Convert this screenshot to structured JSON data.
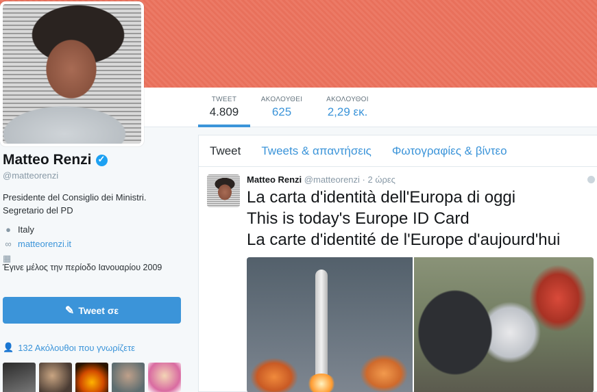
{
  "profile": {
    "name": "Matteo Renzi",
    "handle": "@matteorenzi",
    "bio": "Presidente del Consiglio dei Ministri. Segretario del PD",
    "location": "Italy",
    "website": "matteorenzi.it",
    "joined": "Έγινε μέλος την περίοδο Ιανουαρίου 2009",
    "tweet_to_button": "Tweet σε",
    "followers_you_know": "132 Ακόλουθοι που γνωρίζετε"
  },
  "stats": [
    {
      "label": "TWEET",
      "value": "4.809"
    },
    {
      "label": "ΑΚΟΛΟΥΘΕΙ",
      "value": "625"
    },
    {
      "label": "ΑΚΟΛΟΥΘΟΙ",
      "value": "2,29 εκ."
    }
  ],
  "tabs": [
    {
      "label": "Tweet"
    },
    {
      "label": "Tweets & απαντήσεις"
    },
    {
      "label": "Φωτογραφίες & βίντεο"
    }
  ],
  "tweet": {
    "author": "Matteo Renzi",
    "handle": "@matteorenzi",
    "time": "· 2 ώρες",
    "lines": [
      "La carta d'identità dell'Europa di oggi",
      "This is today's Europe ID Card",
      "La carte d'identité de l'Europe d'aujourd'hui"
    ]
  },
  "icons": {
    "verified": "verified-badge-icon",
    "location": "map-pin-icon",
    "link": "link-icon",
    "calendar": "calendar-icon",
    "pen": "compose-icon",
    "person": "person-icon",
    "globe": "globe-icon"
  },
  "colors": {
    "accent": "#3b94d9",
    "banner": "#ec7a66"
  }
}
